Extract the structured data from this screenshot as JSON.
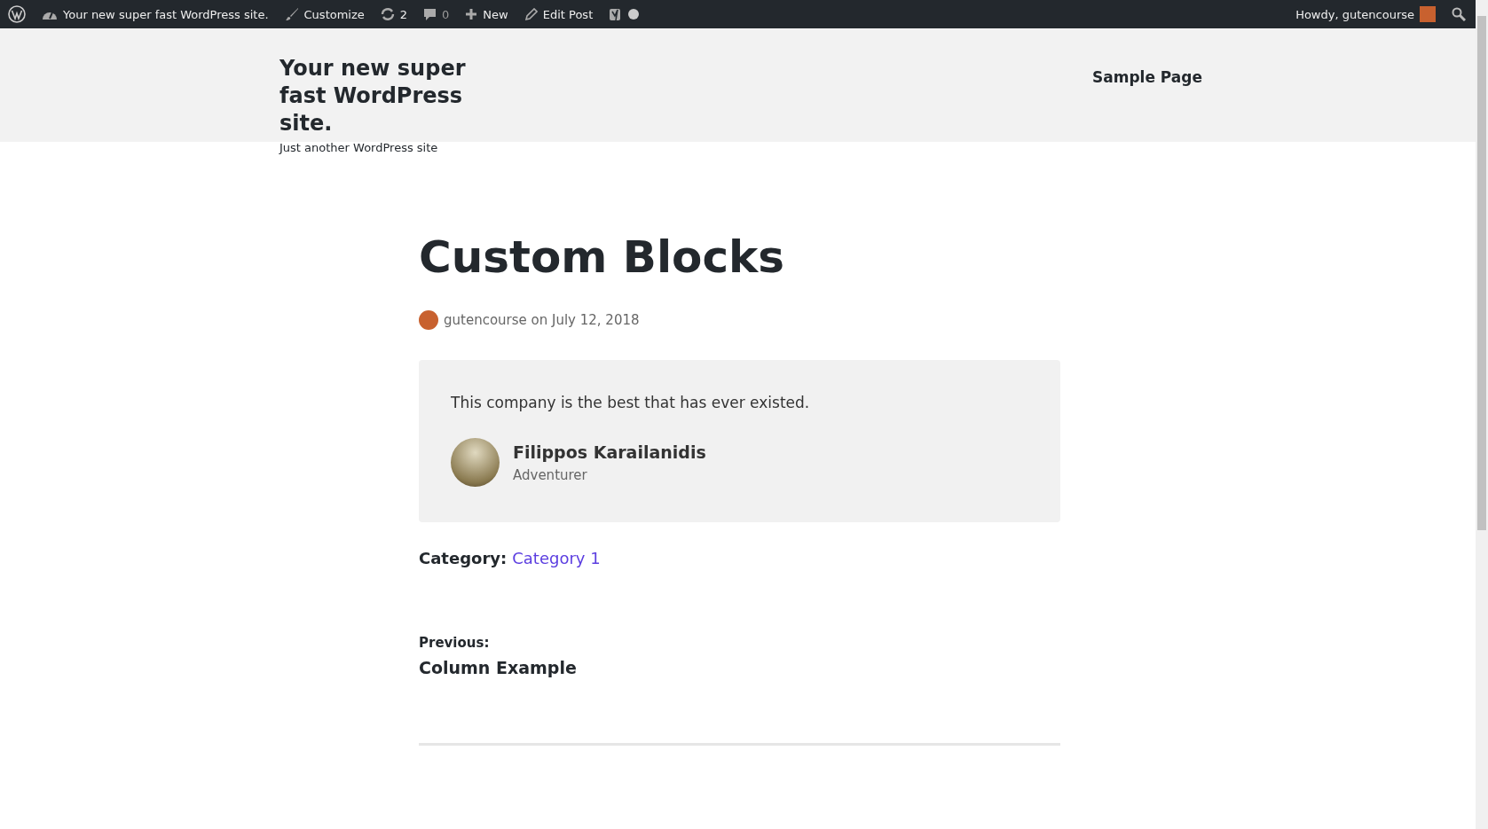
{
  "admin_bar": {
    "site_name": "Your new super fast WordPress site.",
    "customize": "Customize",
    "updates": "2",
    "comments": "0",
    "new": "New",
    "edit_post": "Edit Post",
    "greeting": "Howdy, gutencourse"
  },
  "header": {
    "title": "Your new super fast WordPress site.",
    "tagline": "Just another WordPress site",
    "nav": [
      "Sample Page"
    ]
  },
  "post": {
    "title": "Custom Blocks",
    "byline": "gutencourse on July 12, 2018",
    "testimonial": {
      "quote": "This company is the best that has ever existed.",
      "name": "Filippos Karailanidis",
      "role": "Adventurer"
    },
    "category_label": "Category:",
    "category": "Category 1",
    "previous_label": "Previous:",
    "previous_title": "Column Example"
  }
}
